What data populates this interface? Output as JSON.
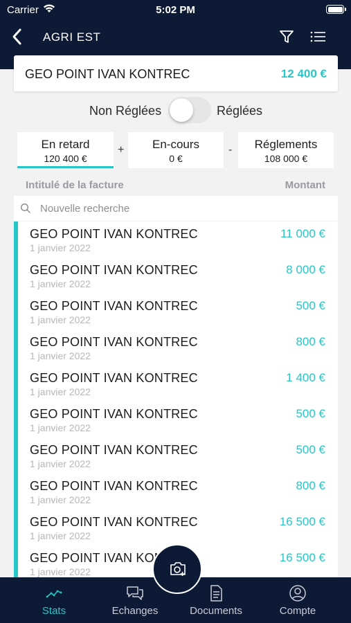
{
  "status_bar": {
    "carrier": "Carrier",
    "time": "5:02 PM"
  },
  "nav": {
    "title": "AGRI EST",
    "icons": [
      "back-chevron-icon",
      "filter-icon",
      "list-icon"
    ]
  },
  "client": {
    "name": "GEO POINT IVAN KONTREC",
    "amount": "12 400 €"
  },
  "toggle": {
    "left_label": "Non Réglées",
    "right_label": "Réglées",
    "on": false
  },
  "summary": {
    "tiles": [
      {
        "label": "En retard",
        "value": "120 400 €",
        "active": true
      },
      {
        "label": "En-cours",
        "value": "0 €",
        "active": false
      },
      {
        "label": "Réglements",
        "value": "108 000 €",
        "active": false
      }
    ],
    "ops": [
      "+",
      "-"
    ]
  },
  "columns": {
    "title": "Intitulé de la facture",
    "amount": "Montant"
  },
  "search": {
    "placeholder": "Nouvelle recherche"
  },
  "invoices": [
    {
      "title": "GEO POINT IVAN KONTREC",
      "date": "1 janvier 2022",
      "amount": "11 000 €"
    },
    {
      "title": "GEO POINT IVAN KONTREC",
      "date": "1 janvier 2022",
      "amount": "8 000 €"
    },
    {
      "title": "GEO POINT IVAN KONTREC",
      "date": "1 janvier 2022",
      "amount": "500 €"
    },
    {
      "title": "GEO POINT IVAN KONTREC",
      "date": "1 janvier 2022",
      "amount": "800 €"
    },
    {
      "title": "GEO POINT IVAN KONTREC",
      "date": "1 janvier 2022",
      "amount": "1 400 €"
    },
    {
      "title": "GEO POINT IVAN KONTREC",
      "date": "1 janvier 2022",
      "amount": "500 €"
    },
    {
      "title": "GEO POINT IVAN KONTREC",
      "date": "1 janvier 2022",
      "amount": "500 €"
    },
    {
      "title": "GEO POINT IVAN KONTREC",
      "date": "1 janvier 2022",
      "amount": "800 €"
    },
    {
      "title": "GEO POINT IVAN KONTREC",
      "date": "1 janvier 2022",
      "amount": "16 500 €"
    },
    {
      "title": "GEO POINT IVAN KONTREC",
      "date": "1 janvier 2022",
      "amount": "16 500 €"
    }
  ],
  "tabs": [
    {
      "label": "Stats",
      "icon": "chart-line-icon",
      "active": true
    },
    {
      "label": "Echanges",
      "icon": "chat-bubbles-icon",
      "active": false
    },
    {
      "label": "Documents",
      "icon": "document-icon",
      "active": false
    },
    {
      "label": "Compte",
      "icon": "user-circle-icon",
      "active": false
    }
  ],
  "fab": {
    "icon": "camera-plus-icon"
  },
  "colors": {
    "navy": "#0d1a36",
    "accent": "#27c6c8",
    "background": "#f2f2f3"
  }
}
